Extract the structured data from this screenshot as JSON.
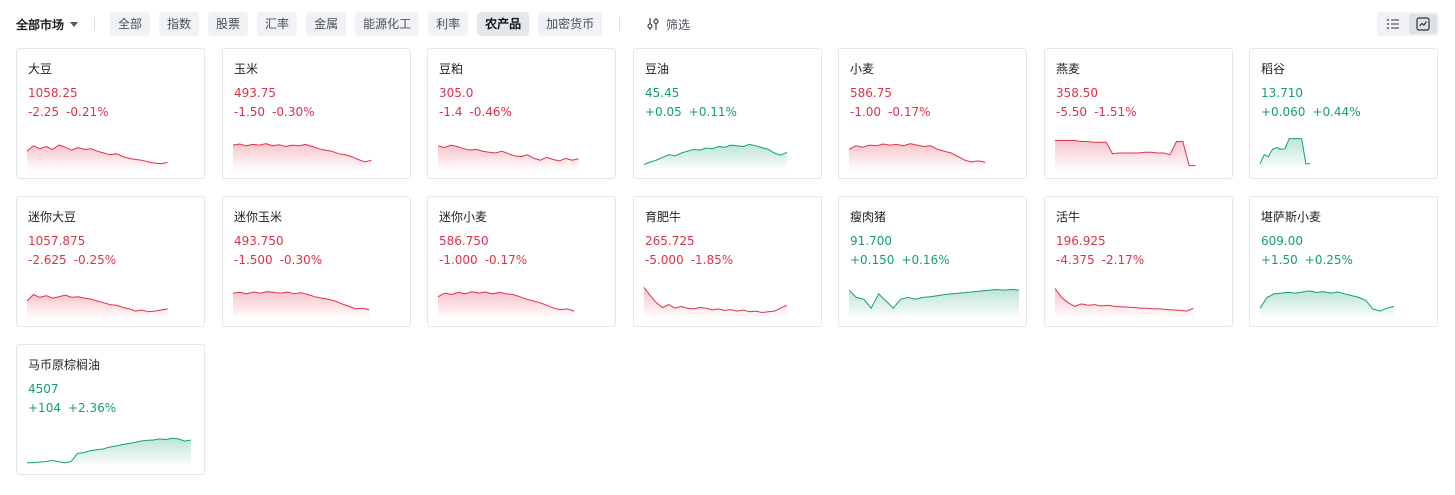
{
  "toolbar": {
    "market_label": "全部市场",
    "tabs": [
      "全部",
      "指数",
      "股票",
      "汇率",
      "金属",
      "能源化工",
      "利率",
      "农产品",
      "加密货币"
    ],
    "active_tab": 7,
    "filter_label": "筛选"
  },
  "colors": {
    "up": "#14a06b",
    "down": "#e0314b"
  },
  "cards": [
    {
      "name": "大豆",
      "price": "1058.25",
      "change": "-2.25",
      "change_pct": "-0.21%",
      "dir": "down",
      "spark": [
        0.55,
        0.7,
        0.62,
        0.68,
        0.6,
        0.72,
        0.66,
        0.58,
        0.65,
        0.6,
        0.62,
        0.55,
        0.5,
        0.45,
        0.48,
        0.4,
        0.35,
        0.32,
        0.3,
        0.25,
        0.22,
        0.2,
        0.24
      ]
    },
    {
      "name": "玉米",
      "price": "493.75",
      "change": "-1.50",
      "change_pct": "-0.30%",
      "dir": "down",
      "spark": [
        0.72,
        0.75,
        0.7,
        0.74,
        0.72,
        0.76,
        0.7,
        0.73,
        0.68,
        0.72,
        0.7,
        0.74,
        0.68,
        0.62,
        0.58,
        0.55,
        0.48,
        0.45,
        0.4,
        0.32,
        0.25,
        0.3
      ]
    },
    {
      "name": "豆粕",
      "price": "305.0",
      "change": "-1.4",
      "change_pct": "-0.46%",
      "dir": "down",
      "spark": [
        0.7,
        0.65,
        0.72,
        0.68,
        0.62,
        0.58,
        0.6,
        0.55,
        0.52,
        0.5,
        0.55,
        0.48,
        0.42,
        0.4,
        0.45,
        0.35,
        0.3,
        0.38,
        0.32,
        0.28,
        0.35,
        0.3,
        0.34
      ]
    },
    {
      "name": "豆油",
      "price": "45.45",
      "change": "+0.05",
      "change_pct": "+0.11%",
      "dir": "up",
      "spark": [
        0.18,
        0.25,
        0.3,
        0.38,
        0.45,
        0.42,
        0.5,
        0.55,
        0.6,
        0.58,
        0.64,
        0.62,
        0.68,
        0.66,
        0.72,
        0.7,
        0.68,
        0.74,
        0.7,
        0.65,
        0.6,
        0.5,
        0.44,
        0.52
      ]
    },
    {
      "name": "小麦",
      "price": "586.75",
      "change": "-1.00",
      "change_pct": "-0.17%",
      "dir": "down",
      "spark": [
        0.6,
        0.7,
        0.66,
        0.72,
        0.7,
        0.75,
        0.72,
        0.74,
        0.7,
        0.76,
        0.72,
        0.68,
        0.7,
        0.6,
        0.55,
        0.5,
        0.4,
        0.3,
        0.25,
        0.28,
        0.24
      ]
    },
    {
      "name": "燕麦",
      "price": "358.50",
      "change": "-5.50",
      "change_pct": "-1.51%",
      "dir": "down",
      "spark": [
        0.85,
        0.85,
        0.85,
        0.85,
        0.82,
        0.82,
        0.8,
        0.8,
        0.8,
        0.48,
        0.5,
        0.5,
        0.5,
        0.5,
        0.52,
        0.52,
        0.5,
        0.5,
        0.45,
        0.82,
        0.82,
        0.15,
        0.15
      ]
    },
    {
      "name": "稻谷",
      "price": "13.710",
      "change": "+0.060",
      "change_pct": "+0.44%",
      "dir": "up",
      "spark": [
        0.2,
        0.45,
        0.4,
        0.6,
        0.65,
        0.6,
        0.62,
        0.9,
        0.9,
        0.9,
        0.9,
        0.2,
        0.2
      ]
    },
    {
      "name": "迷你大豆",
      "price": "1057.875",
      "change": "-2.625",
      "change_pct": "-0.25%",
      "dir": "down",
      "spark": [
        0.5,
        0.68,
        0.6,
        0.65,
        0.58,
        0.62,
        0.66,
        0.6,
        0.62,
        0.58,
        0.55,
        0.5,
        0.45,
        0.4,
        0.38,
        0.32,
        0.28,
        0.22,
        0.25,
        0.2,
        0.22,
        0.25,
        0.28
      ]
    },
    {
      "name": "迷你玉米",
      "price": "493.750",
      "change": "-1.500",
      "change_pct": "-0.30%",
      "dir": "down",
      "spark": [
        0.72,
        0.74,
        0.7,
        0.75,
        0.72,
        0.76,
        0.74,
        0.72,
        0.75,
        0.7,
        0.73,
        0.68,
        0.62,
        0.58,
        0.55,
        0.5,
        0.42,
        0.35,
        0.28,
        0.3,
        0.26
      ]
    },
    {
      "name": "迷你小麦",
      "price": "586.750",
      "change": "-1.000",
      "change_pct": "-0.17%",
      "dir": "down",
      "spark": [
        0.62,
        0.72,
        0.68,
        0.74,
        0.7,
        0.76,
        0.72,
        0.75,
        0.7,
        0.74,
        0.7,
        0.68,
        0.62,
        0.55,
        0.5,
        0.45,
        0.38,
        0.3,
        0.26,
        0.28,
        0.22
      ]
    },
    {
      "name": "育肥牛",
      "price": "265.725",
      "change": "-5.000",
      "change_pct": "-1.85%",
      "dir": "down",
      "spark": [
        0.88,
        0.65,
        0.45,
        0.32,
        0.4,
        0.3,
        0.35,
        0.3,
        0.28,
        0.32,
        0.3,
        0.25,
        0.28,
        0.24,
        0.26,
        0.22,
        0.25,
        0.2,
        0.22,
        0.18,
        0.2,
        0.22,
        0.3,
        0.38
      ]
    },
    {
      "name": "瘦肉猪",
      "price": "91.700",
      "change": "+0.150",
      "change_pct": "+0.16%",
      "dir": "up",
      "spark": [
        0.8,
        0.6,
        0.55,
        0.3,
        0.7,
        0.5,
        0.3,
        0.55,
        0.6,
        0.55,
        0.6,
        0.62,
        0.65,
        0.68,
        0.7,
        0.72,
        0.74,
        0.76,
        0.78,
        0.8,
        0.82,
        0.8,
        0.82,
        0.8
      ]
    },
    {
      "name": "活牛",
      "price": "196.925",
      "change": "-4.375",
      "change_pct": "-2.17%",
      "dir": "down",
      "spark": [
        0.85,
        0.6,
        0.45,
        0.35,
        0.42,
        0.38,
        0.4,
        0.36,
        0.38,
        0.35,
        0.34,
        0.33,
        0.32,
        0.3,
        0.3,
        0.28,
        0.28,
        0.26,
        0.25,
        0.24,
        0.22,
        0.3
      ]
    },
    {
      "name": "堪萨斯小麦",
      "price": "609.00",
      "change": "+1.50",
      "change_pct": "+0.25%",
      "dir": "up",
      "spark": [
        0.3,
        0.6,
        0.7,
        0.72,
        0.74,
        0.72,
        0.75,
        0.78,
        0.74,
        0.76,
        0.72,
        0.75,
        0.7,
        0.65,
        0.6,
        0.52,
        0.28,
        0.22,
        0.3,
        0.35
      ]
    },
    {
      "name": "马币原棕榈油",
      "price": "4507",
      "change": "+104",
      "change_pct": "+2.36%",
      "dir": "up",
      "spark": [
        0.12,
        0.12,
        0.14,
        0.15,
        0.18,
        0.15,
        0.12,
        0.15,
        0.38,
        0.4,
        0.45,
        0.48,
        0.5,
        0.55,
        0.58,
        0.62,
        0.65,
        0.68,
        0.72,
        0.74,
        0.75,
        0.78,
        0.76,
        0.8,
        0.78,
        0.72,
        0.75
      ]
    }
  ]
}
